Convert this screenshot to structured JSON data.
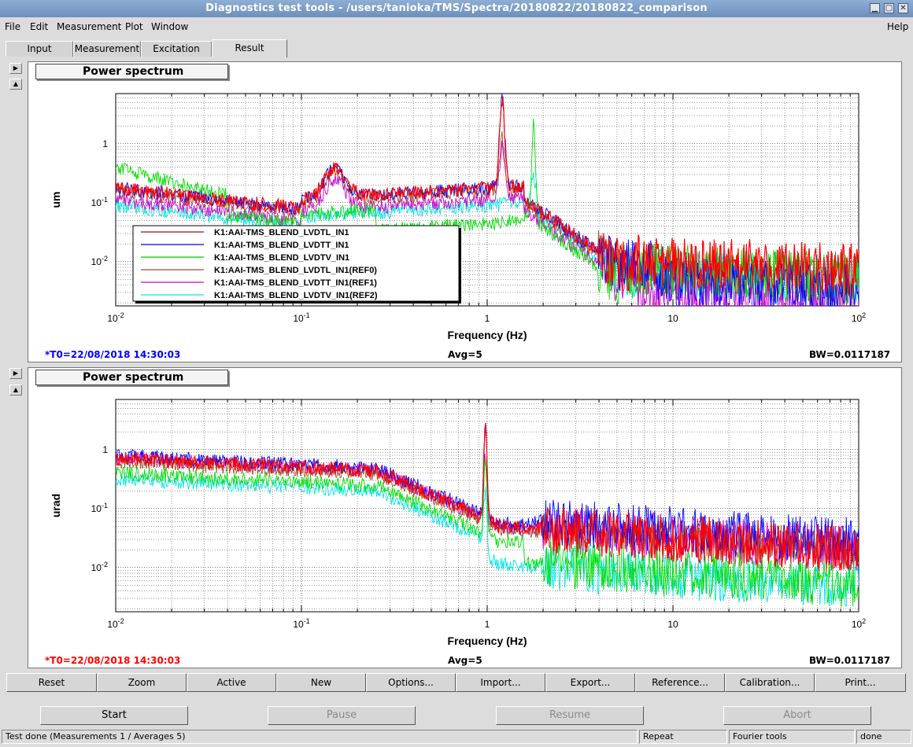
{
  "window": {
    "title": "Diagnostics test tools - /users/tanioka/TMS/Spectra/20180822/20180822_comparison"
  },
  "menu": {
    "file": "File",
    "edit": "Edit",
    "measurement": "Measurement",
    "plot": "Plot",
    "window": "Window",
    "help": "Help"
  },
  "tabs": [
    {
      "label": "Input"
    },
    {
      "label": "Measurement"
    },
    {
      "label": "Excitation"
    },
    {
      "label": "Result",
      "active": true
    }
  ],
  "colors": {
    "red": "#ff0000",
    "blue": "#0000ff",
    "green": "#00dd00",
    "brown": "#a0522d",
    "magenta": "#cc00cc",
    "cyan": "#00e5e5"
  },
  "plots": [
    {
      "title": "Power spectrum",
      "ylabel": "um",
      "xlabel": "Frequency (Hz)",
      "yticks": [
        "1",
        "10-1",
        "10-2"
      ],
      "xticks": [
        "10-2",
        "10-1",
        "1",
        "10",
        "102"
      ],
      "t0": "*T0=22/08/2018 14:30:03",
      "t0_color": "#0000ff",
      "avg": "Avg=5",
      "bw": "BW=0.0117187",
      "legend": [
        {
          "label": "K1:AAI-TMS_BLEND_LVDTL_IN1",
          "color": "#a01010"
        },
        {
          "label": "K1:AAI-TMS_BLEND_LVDTT_IN1",
          "color": "#0000ff"
        },
        {
          "label": "K1:AAI-TMS_BLEND_LVDTV_IN1",
          "color": "#00cc00"
        },
        {
          "label": "K1:AAI-TMS_BLEND_LVDTL_IN1(REF0)",
          "color": "#a0522d"
        },
        {
          "label": "K1:AAI-TMS_BLEND_LVDTT_IN1(REF1)",
          "color": "#cc00cc"
        },
        {
          "label": "K1:AAI-TMS_BLEND_LVDTV_IN1(REF2)",
          "color": "#00e5e5"
        }
      ]
    },
    {
      "title": "Power spectrum",
      "ylabel": "urad",
      "xlabel": "Frequency (Hz)",
      "yticks": [
        "1",
        "10-1",
        "10-2"
      ],
      "xticks": [
        "10-2",
        "10-1",
        "1",
        "10",
        "102"
      ],
      "t0": "*T0=22/08/2018 14:30:03",
      "t0_color": "#ff0000",
      "avg": "Avg=5",
      "bw": "BW=0.0117187"
    }
  ],
  "buttons": [
    "Reset",
    "Zoom",
    "Active",
    "New",
    "Options...",
    "Import...",
    "Export...",
    "Reference...",
    "Calibration...",
    "Print..."
  ],
  "controls": [
    {
      "label": "Start",
      "enabled": true
    },
    {
      "label": "Pause",
      "enabled": false
    },
    {
      "label": "Resume",
      "enabled": false
    },
    {
      "label": "Abort",
      "enabled": false
    }
  ],
  "status": {
    "message": "Test done (Measurements 1 / Averages 5)",
    "repeat": "Repeat",
    "tool": "Fourier tools",
    "state": "done"
  }
}
